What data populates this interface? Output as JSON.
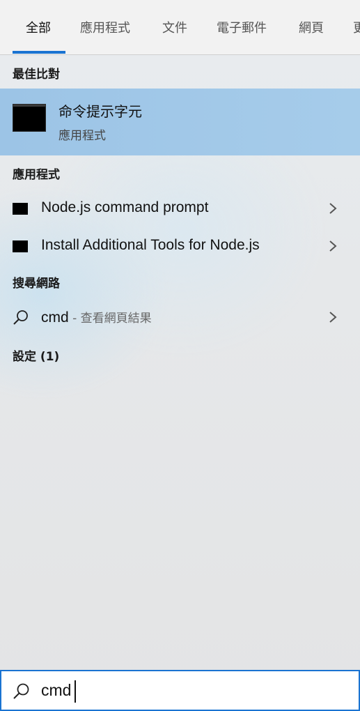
{
  "tabs": [
    {
      "label": "全部",
      "active": true
    },
    {
      "label": "應用程式"
    },
    {
      "label": "文件"
    },
    {
      "label": "電子郵件"
    },
    {
      "label": "網頁"
    },
    {
      "label": "更"
    }
  ],
  "best_match": {
    "header": "最佳比對",
    "title": "命令提示字元",
    "subtitle": "應用程式",
    "icon": "command-prompt-icon"
  },
  "apps": {
    "header": "應用程式",
    "items": [
      {
        "label": "Node.js command prompt",
        "icon": "console-icon"
      },
      {
        "label": "Install Additional Tools for Node.js",
        "icon": "console-icon"
      }
    ]
  },
  "web": {
    "header": "搜尋網路",
    "query": "cmd",
    "suffix": " - 查看網頁結果",
    "icon": "search-icon"
  },
  "settings": {
    "header": "設定 (1)"
  },
  "search": {
    "value": "cmd",
    "icon": "search-icon"
  },
  "colors": {
    "accent": "#1a73d1",
    "selection": "#9cc4e6"
  }
}
